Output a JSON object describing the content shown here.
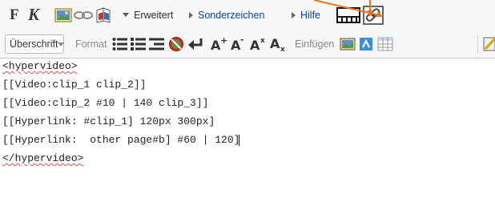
{
  "toolbar_top": {
    "bold_label": "F",
    "italic_label": "K",
    "advanced_label": "Erweitert",
    "special_chars_label": "Sonderzeichen",
    "help_label": "Hilfe"
  },
  "toolbar_bottom": {
    "heading_select_value": "Überschrift",
    "format_label": "Format",
    "insert_label": "Einfügen"
  },
  "editor": {
    "lines": [
      "<hypervideo>",
      "[[Video:clip_1 clip_2]]",
      "[[Video:clip_2 #10 | 140 clip_3]]",
      "[[Hyperlink: #clip_1] 120px 300px]",
      "[[Hyperlink:  other page#b] #60 | 120]",
      "</hypervideo>"
    ]
  },
  "colors": {
    "toolbar_bg": "#f7f7f7",
    "link": "#0645ad",
    "annotation_arrow": "#e8791b",
    "spellcheck": "#d9534f"
  }
}
